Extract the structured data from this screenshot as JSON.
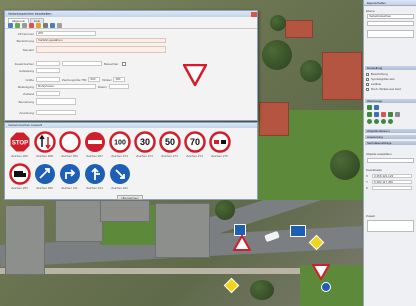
{
  "dialog": {
    "title": "Verkehrszeichen bearbeiten",
    "tabs": [
      "Allgemein",
      "Foto"
    ],
    "fields": [
      {
        "label": "VZ-Nummer",
        "value": "205"
      },
      {
        "label": "Bezeichnung",
        "value": "Vorfahrt gewähren"
      },
      {
        "label": "Standort",
        "value": ""
      },
      {
        "label": "Zusatzzeichen",
        "value": ""
      },
      {
        "label": "Aufstellung",
        "value": ""
      },
      {
        "label": "Größe",
        "value": ""
      },
      {
        "label": "Befestigung",
        "value": "Rohrpfosten"
      },
      {
        "label": "Zustand",
        "value": ""
      },
      {
        "label": "Bemerkung",
        "value": ""
      },
      {
        "label": "Anordnung",
        "value": ""
      }
    ],
    "inline": {
      "size_label": "Zeichengröße 750",
      "size_value": "600",
      "angle_label": "Winkel",
      "angle_value": "180",
      "date_label": "Datum",
      "check_label": "Beleuchtet"
    }
  },
  "palette": {
    "title": "Verkehrszeichen Auswahl",
    "row1": [
      {
        "icon": "stop-sign-icon",
        "text": "STOP",
        "cap": "Zeichen 206"
      },
      {
        "icon": "oncoming-traffic-icon",
        "text": "",
        "cap": "Zeichen 208"
      },
      {
        "icon": "no-vehicles-icon",
        "text": "",
        "cap": "Zeichen 250"
      },
      {
        "icon": "no-entry-icon",
        "text": "",
        "cap": "Zeichen 267"
      },
      {
        "icon": "speed-limit-icon",
        "text": "100",
        "cap": "Zeichen 274"
      },
      {
        "icon": "speed-limit-icon",
        "text": "30",
        "cap": "Zeichen 274"
      },
      {
        "icon": "speed-limit-icon",
        "text": "50",
        "cap": "Zeichen 274"
      },
      {
        "icon": "speed-limit-icon",
        "text": "70",
        "cap": "Zeichen 274"
      },
      {
        "icon": "no-overtaking-icon",
        "text": "",
        "cap": "Zeichen 276"
      }
    ],
    "row2": [
      {
        "icon": "truck-sign-icon",
        "cap": "Zeichen 253"
      },
      {
        "icon": "blue-mandatory-icon",
        "cap": "Zeichen 209"
      },
      {
        "icon": "blue-mandatory-icon",
        "cap": "Zeichen 211"
      },
      {
        "icon": "blue-mandatory-icon",
        "cap": "Zeichen 214"
      },
      {
        "icon": "blue-mandatory-icon",
        "cap": "Zeichen 222"
      }
    ],
    "ok_label": "Übernehmen"
  },
  "right_panel": {
    "title": "Eigenschaften",
    "layer_label": "Ebene",
    "layer_value": "Verkehrszeichen",
    "display_label": "Darstellung",
    "display_options": [
      "Beschriftung",
      "Symbolgröße fest",
      "Leitlinie",
      "Dreh.-Winkel aus Feld"
    ],
    "tools_label": "Werkzeuge",
    "sections": [
      "Objektfunktionen",
      "Auswertung",
      "Sachdatenabfrage"
    ],
    "objects_label": "Objekte auswählen",
    "objects_value": "",
    "coords_label": "Koordinaten",
    "coord_rows": [
      {
        "axis": "X",
        "value": "3 456 421.123"
      },
      {
        "axis": "Y",
        "value": "5 482 117.456"
      },
      {
        "axis": "Z",
        "value": ""
      }
    ],
    "extra_label": "Zusatz"
  },
  "colors": {
    "sign_red": "#d21e2b",
    "sign_blue": "#1d5fb4",
    "marker_yellow": "#f0d51b",
    "accent": "#c3d3e8"
  }
}
